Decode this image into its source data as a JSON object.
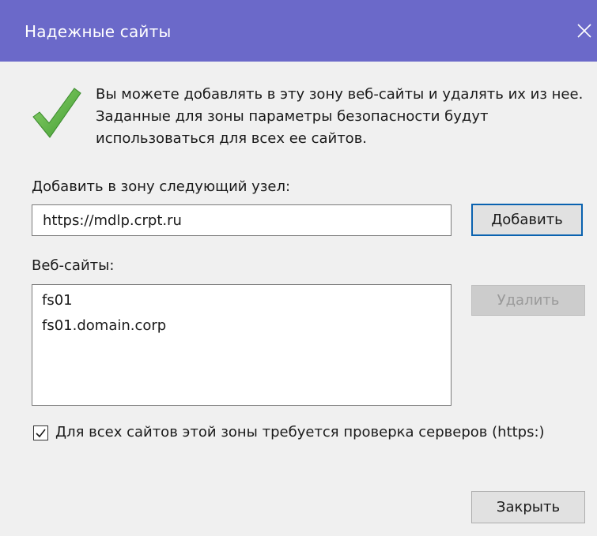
{
  "window": {
    "title": "Надежные сайты",
    "close_icon": "close-icon"
  },
  "info": {
    "icon": "checkmark-icon",
    "text": "Вы можете добавлять в эту зону  веб-сайты и удалять их из нее. Заданные для зоны параметры безопасности будут использоваться для всех ее сайтов."
  },
  "add_zone": {
    "label": "Добавить в зону следующий узел:",
    "value": "https://mdlp.crpt.ru",
    "button_label": "Добавить"
  },
  "websites": {
    "label": "Веб-сайты:",
    "items": [
      "fs01",
      "fs01.domain.corp"
    ],
    "remove_label": "Удалить"
  },
  "require_https": {
    "checked": true,
    "label": "Для всех сайтов этой зоны требуется проверка серверов (https:)"
  },
  "footer": {
    "close_label": "Закрыть"
  },
  "colors": {
    "titlebar": "#6b69c9",
    "background": "#f0f0f0",
    "default_button_border": "#0a62b0",
    "check_green": "#4aa83a"
  }
}
